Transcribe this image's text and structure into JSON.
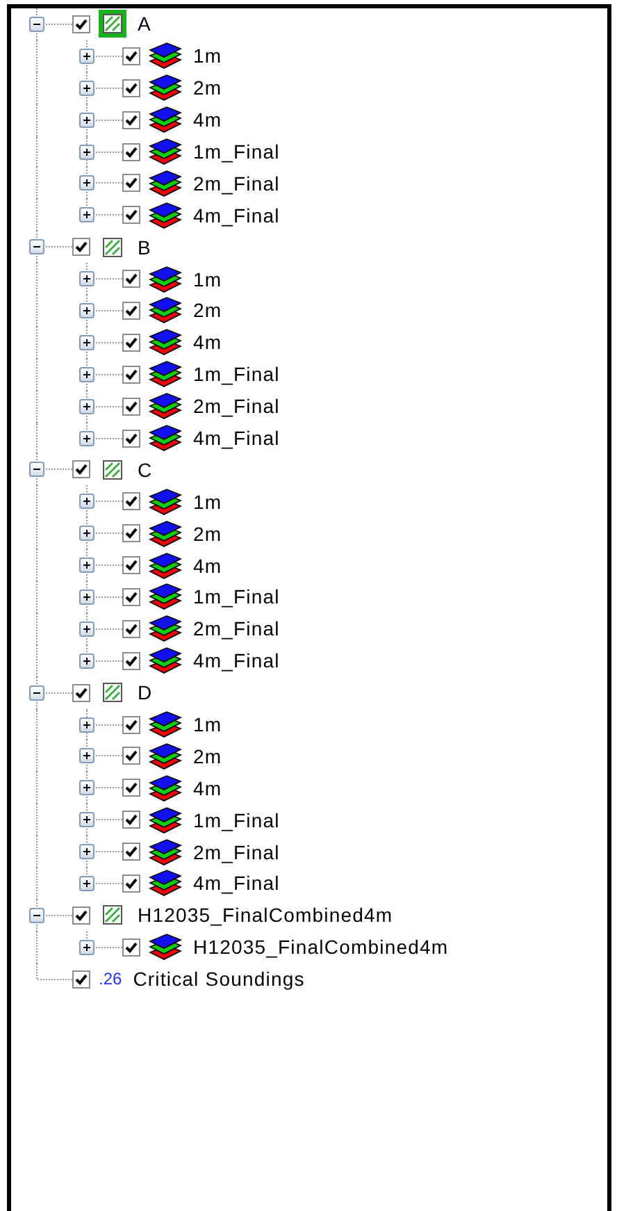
{
  "layers": [
    {
      "kind": "group",
      "name": "A",
      "expanded": true,
      "checked": true,
      "selected": true,
      "children": [
        {
          "kind": "raster",
          "name": "1m",
          "expanded": false,
          "checked": true
        },
        {
          "kind": "raster",
          "name": "2m",
          "expanded": false,
          "checked": true
        },
        {
          "kind": "raster",
          "name": "4m",
          "expanded": false,
          "checked": true
        },
        {
          "kind": "raster",
          "name": "1m_Final",
          "expanded": false,
          "checked": true
        },
        {
          "kind": "raster",
          "name": "2m_Final",
          "expanded": false,
          "checked": true
        },
        {
          "kind": "raster",
          "name": "4m_Final",
          "expanded": false,
          "checked": true
        }
      ]
    },
    {
      "kind": "group",
      "name": "B",
      "expanded": true,
      "checked": true,
      "selected": false,
      "children": [
        {
          "kind": "raster",
          "name": "1m",
          "expanded": false,
          "checked": true
        },
        {
          "kind": "raster",
          "name": "2m",
          "expanded": false,
          "checked": true
        },
        {
          "kind": "raster",
          "name": "4m",
          "expanded": false,
          "checked": true
        },
        {
          "kind": "raster",
          "name": "1m_Final",
          "expanded": false,
          "checked": true
        },
        {
          "kind": "raster",
          "name": "2m_Final",
          "expanded": false,
          "checked": true
        },
        {
          "kind": "raster",
          "name": "4m_Final",
          "expanded": false,
          "checked": true
        }
      ]
    },
    {
      "kind": "group",
      "name": "C",
      "expanded": true,
      "checked": true,
      "selected": false,
      "children": [
        {
          "kind": "raster",
          "name": "1m",
          "expanded": false,
          "checked": true
        },
        {
          "kind": "raster",
          "name": "2m",
          "expanded": false,
          "checked": true
        },
        {
          "kind": "raster",
          "name": "4m",
          "expanded": false,
          "checked": true
        },
        {
          "kind": "raster",
          "name": "1m_Final",
          "expanded": false,
          "checked": true
        },
        {
          "kind": "raster",
          "name": "2m_Final",
          "expanded": false,
          "checked": true
        },
        {
          "kind": "raster",
          "name": "4m_Final",
          "expanded": false,
          "checked": true
        }
      ]
    },
    {
      "kind": "group",
      "name": "D",
      "expanded": true,
      "checked": true,
      "selected": false,
      "children": [
        {
          "kind": "raster",
          "name": "1m",
          "expanded": false,
          "checked": true
        },
        {
          "kind": "raster",
          "name": "2m",
          "expanded": false,
          "checked": true
        },
        {
          "kind": "raster",
          "name": "4m",
          "expanded": false,
          "checked": true
        },
        {
          "kind": "raster",
          "name": "1m_Final",
          "expanded": false,
          "checked": true
        },
        {
          "kind": "raster",
          "name": "2m_Final",
          "expanded": false,
          "checked": true
        },
        {
          "kind": "raster",
          "name": "4m_Final",
          "expanded": false,
          "checked": true
        }
      ]
    },
    {
      "kind": "group",
      "name": "H12035_FinalCombined4m",
      "expanded": true,
      "checked": true,
      "selected": false,
      "children": [
        {
          "kind": "raster",
          "name": "H12035_FinalCombined4m",
          "expanded": false,
          "checked": true
        }
      ]
    },
    {
      "kind": "soundings",
      "name": "Critical Soundings",
      "icon_text": ".26",
      "checked": true
    }
  ]
}
